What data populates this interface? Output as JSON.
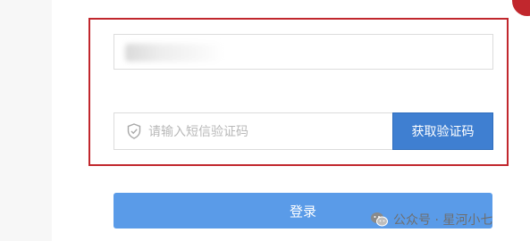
{
  "form": {
    "phone_value": "",
    "code_placeholder": "请输入短信验证码",
    "get_code_label": "获取验证码",
    "login_label": "登录"
  },
  "watermark": {
    "text": "公众号 · 星河小七",
    "icon": "wechat-icon"
  },
  "colors": {
    "highlight": "#c1272d",
    "get_code_button": "#3f7fd1",
    "login_button": "#5a9be8",
    "placeholder_text": "#b9b9b9"
  },
  "icons": {
    "code_field": "shield-icon"
  }
}
